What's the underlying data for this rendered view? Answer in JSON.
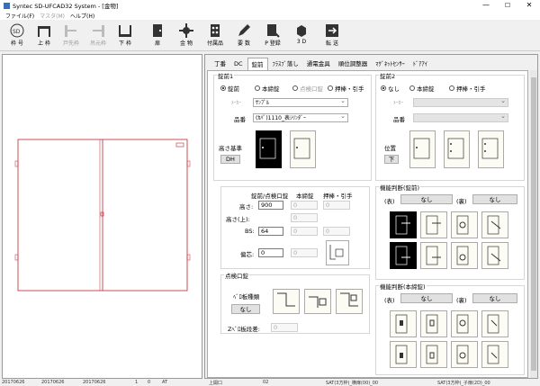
{
  "window": {
    "title": "Syntec SD-UFCAD32 System - [金物]",
    "min": "—",
    "max": "☐",
    "close": "✕"
  },
  "menu": [
    {
      "label": "ファイル(F)",
      "enabled": true
    },
    {
      "label": "マスタ(M)",
      "enabled": false
    },
    {
      "label": "ヘルプ(H)",
      "enabled": true
    }
  ],
  "toolbar": {
    "items": [
      {
        "label": "枠 号",
        "icon": "sd-icon",
        "enabled": true
      },
      {
        "label": "上 枠",
        "icon": "top-frame-icon",
        "enabled": true
      },
      {
        "label": "戸先枠",
        "icon": "door-tip-frame-icon",
        "enabled": false
      },
      {
        "label": "吊元枠",
        "icon": "hinge-frame-icon",
        "enabled": false
      },
      {
        "label": "下 枠",
        "icon": "bottom-frame-icon",
        "enabled": true
      },
      {
        "label": "扉",
        "icon": "door-icon",
        "enabled": true
      },
      {
        "label": "金 物",
        "icon": "hardware-icon",
        "enabled": true
      },
      {
        "label": "付属品",
        "icon": "accessory-icon",
        "enabled": true
      },
      {
        "label": "要 数",
        "icon": "pencil-icon",
        "enabled": true
      },
      {
        "label": "P 登録",
        "icon": "register-icon",
        "enabled": true
      },
      {
        "label": "3 D",
        "icon": "3d-icon",
        "enabled": true
      },
      {
        "label": "転 送",
        "icon": "transfer-icon",
        "enabled": true
      }
    ]
  },
  "tabs": [
    "丁番",
    "DC",
    "錠前",
    "ﾌﾗｽﾌﾞ落し",
    "通電金具",
    "順位調整器",
    "ﾏｸﾞﾈｯﾄｾﾝｻｰ",
    "ﾄﾞｱｱｲ"
  ],
  "lock1": {
    "title": "錠前1",
    "radios": [
      {
        "label": "錠前",
        "checked": true
      },
      {
        "label": "本締錠",
        "checked": false
      },
      {
        "label": "点検口錠",
        "checked": false
      },
      {
        "label": "押棒・引手",
        "checked": false
      }
    ],
    "maker_label": "ﾒｰｶｰ",
    "maker_value": "ｻﾝﾌﾟﾙ",
    "product_label": "品番",
    "product_value": "(ｶﾊﾟ)1110_表ｼﾘﾝﾀﾞｰ",
    "height_base_label": "高さ基準",
    "height_base_btn": "DH"
  },
  "lock2": {
    "title": "錠前2",
    "radios": [
      {
        "label": "なし",
        "checked": true
      },
      {
        "label": "本締錠",
        "checked": false
      },
      {
        "label": "押棒・引手",
        "checked": false
      }
    ],
    "maker_label": "ﾒｰｶｰ",
    "product_label": "品番",
    "position_label": "位置",
    "position_btn": "下"
  },
  "dims": {
    "col_headers": [
      "錠前/点検口錠",
      "本締錠",
      "押棒・引手"
    ],
    "rows": [
      {
        "label": "高さ:",
        "v1": "900",
        "v2": "0",
        "v3": "0"
      },
      {
        "label": "高さ(上):",
        "v2": "0"
      },
      {
        "label": "BS:",
        "v1": "64",
        "v2": "0",
        "v3": "0"
      },
      {
        "label": "偏芯:",
        "v1": "0",
        "v2": "0"
      }
    ]
  },
  "inspection": {
    "title": "点検口錠",
    "plate_label": "ﾍﾞﾛ板種類",
    "plate_btn": "なし",
    "z_label": "Zﾍﾞﾛ板段差:",
    "z_value": "0"
  },
  "func1": {
    "title": "機能判断(錠前)",
    "front_label": "(表)",
    "front_btn": "なし",
    "back_label": "(裏)",
    "back_btn": "なし"
  },
  "func2": {
    "title": "機能判断(本締錠)",
    "front_label": "(表)",
    "front_btn": "なし",
    "back_label": "(裏)",
    "back_btn": "なし"
  },
  "statusbar": [
    "20170626",
    "20170626",
    "20170626",
    "1",
    "0",
    "AT",
    "上開口",
    "02",
    "SAT(3方枠)_横扉(00)_00",
    "SAT(3方枠)_子扉(2D)_00"
  ],
  "colors": {
    "drawing": "#c0242b",
    "accent": "#3a6fb8"
  }
}
